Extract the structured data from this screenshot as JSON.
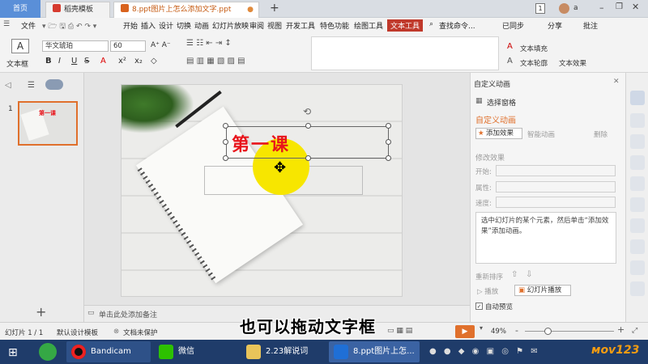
{
  "tabs": {
    "home": "首页",
    "template": "稻壳模板",
    "doc": "8.ppt图片上怎么添加文字.ppt",
    "add": "+",
    "page_badge": "1",
    "user": "a"
  },
  "menu": {
    "file": "文件",
    "items": [
      "开始",
      "插入",
      "设计",
      "切换",
      "动画",
      "幻灯片放映",
      "审阅",
      "视图",
      "开发工具",
      "特色功能",
      "绘图工具"
    ],
    "active": "文本工具",
    "search": "查找命令...",
    "sync": "已同步",
    "share": "分享",
    "comment": "批注"
  },
  "ribbon": {
    "textbox": "文本框",
    "font": "华文琥珀",
    "size": "60",
    "text_fill": "文本填充",
    "text_outline": "文本轮廓",
    "text_effect": "文本效果",
    "style_glyph": "A"
  },
  "thumbs": {
    "slide_number": "1",
    "thumb_title": "第一课"
  },
  "slide": {
    "title": "第一课"
  },
  "notes": {
    "placeholder": "单击此处添加备注"
  },
  "panel": {
    "header": "自定义动画",
    "selection_pane": "选择窗格",
    "custom_anim": "自定义动画",
    "add_effect": "添加效果",
    "smart_anim": "智能动画",
    "delete": "删除",
    "modify_effect": "修改效果",
    "start": "开始:",
    "property": "属性:",
    "speed": "速度:",
    "hint": "选中幻灯片的某个元素，然后单击“添加效果”添加动画。",
    "reorder": "重新排序",
    "play": "播放",
    "slideshow": "幻灯片播放",
    "autopreview": "自动预览"
  },
  "status": {
    "slide_count": "幻灯片 1 / 1",
    "design": "默认设计模板",
    "protect": "文档未保护",
    "zoom": "49%",
    "minus": "-",
    "plus": "+"
  },
  "taskbar": {
    "bandicam": "Bandicam",
    "wechat": "微信",
    "folder": "2.23解说词",
    "wps": "8.ppt图片上怎..."
  },
  "subtitle": "也可以拖动文字框",
  "colors": {
    "accent": "#c0392b",
    "title_red": "#e8141b",
    "highlight": "#f7e600",
    "tab_orange": "#c55a11"
  }
}
